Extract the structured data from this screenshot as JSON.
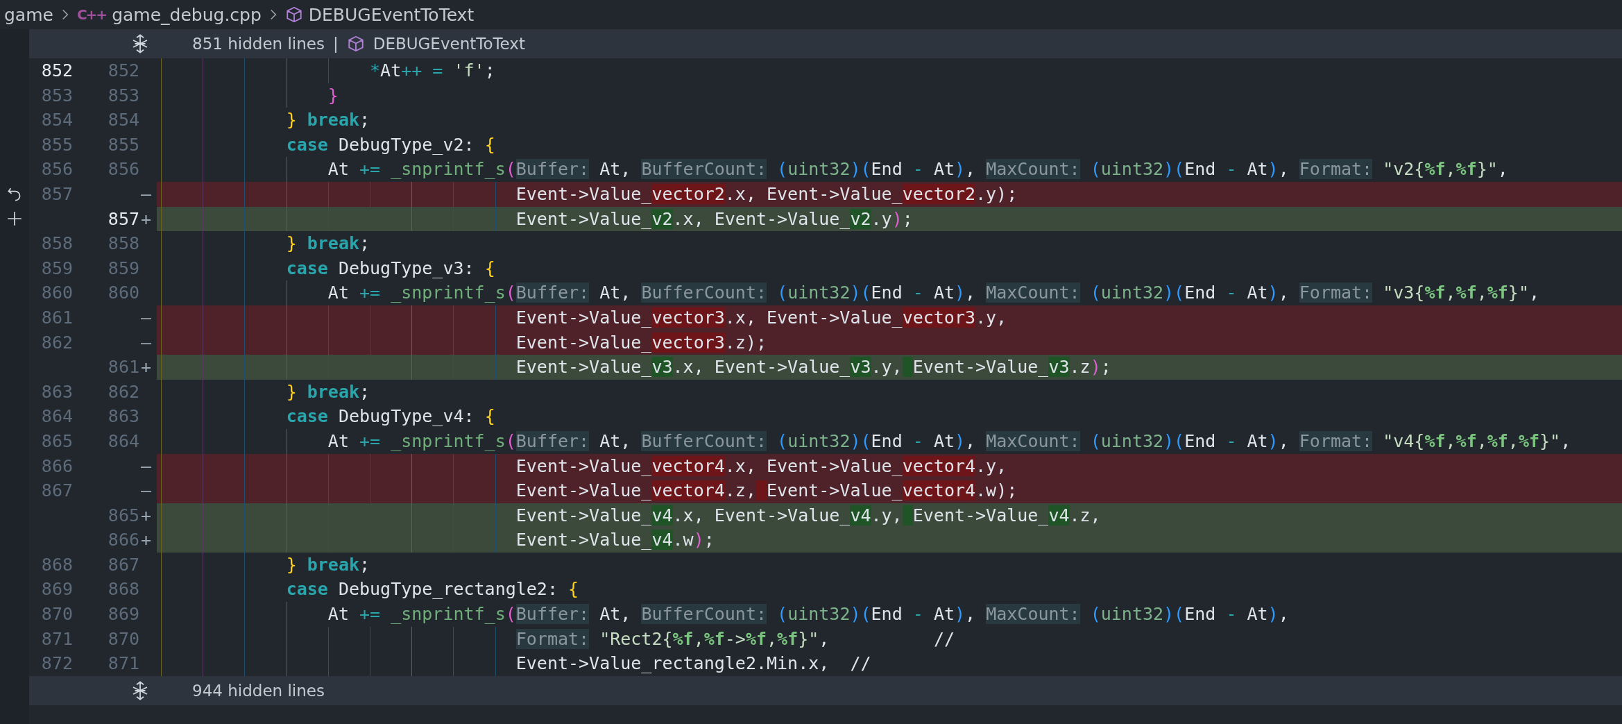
{
  "breadcrumbs": [
    {
      "kind": "folder",
      "text": "game"
    },
    {
      "kind": "file",
      "icon": "C++",
      "text": "game_debug.cpp"
    },
    {
      "kind": "symbol",
      "text": "DEBUGEventToText"
    }
  ],
  "top_fold": {
    "label": "851 hidden lines",
    "separator": "|",
    "symbol": "DEBUGEventToText"
  },
  "lines": [
    {
      "old": "852",
      "new": "852",
      "kind": "context",
      "active": true,
      "hovered": false,
      "code": [
        {
          "kind": "op",
          "text": "                    *"
        },
        {
          "kind": "plain",
          "text": "At"
        },
        {
          "kind": "op",
          "text": "++ = "
        },
        {
          "kind": "str",
          "text": "'f'"
        },
        {
          "kind": "plain",
          "text": ";"
        }
      ]
    },
    {
      "old": "853",
      "new": "853",
      "kind": "context",
      "active": false,
      "hovered": false,
      "code": [
        {
          "kind": "p1",
          "text": "                }"
        }
      ]
    },
    {
      "old": "854",
      "new": "854",
      "kind": "context",
      "active": false,
      "hovered": false,
      "code": [
        {
          "kind": "p3",
          "text": "            }"
        },
        {
          "kind": "keyword",
          "text": " break"
        },
        {
          "kind": "plain",
          "text": ";"
        }
      ]
    },
    {
      "old": "855",
      "new": "855",
      "kind": "context",
      "active": false,
      "hovered": false,
      "code": [
        {
          "kind": "keyword",
          "text": "            case"
        },
        {
          "kind": "plain",
          "text": " DebugType_v2: "
        },
        {
          "kind": "p3",
          "text": "{"
        }
      ]
    },
    {
      "old": "856",
      "new": "856",
      "kind": "context",
      "active": false,
      "hovered": false,
      "code": [
        {
          "kind": "plain",
          "text": "                At "
        },
        {
          "kind": "op",
          "text": "+= "
        },
        {
          "kind": "func",
          "text": "_snprintf_s"
        },
        {
          "kind": "p1",
          "text": "("
        },
        {
          "kind": "hint",
          "text": "Buffer:"
        },
        {
          "kind": "plain",
          "text": " At, "
        },
        {
          "kind": "hint",
          "text": "BufferCount:"
        },
        {
          "kind": "p2",
          "text": " ("
        },
        {
          "kind": "type",
          "text": "uint32"
        },
        {
          "kind": "p2",
          "text": ")("
        },
        {
          "kind": "plain",
          "text": "End "
        },
        {
          "kind": "op",
          "text": "- "
        },
        {
          "kind": "plain",
          "text": "At"
        },
        {
          "kind": "p2",
          "text": ")"
        },
        {
          "kind": "plain",
          "text": ", "
        },
        {
          "kind": "hint",
          "text": "MaxCount:"
        },
        {
          "kind": "p2",
          "text": " ("
        },
        {
          "kind": "type",
          "text": "uint32"
        },
        {
          "kind": "p2",
          "text": ")("
        },
        {
          "kind": "plain",
          "text": "End "
        },
        {
          "kind": "op",
          "text": "- "
        },
        {
          "kind": "plain",
          "text": "At"
        },
        {
          "kind": "p2",
          "text": ")"
        },
        {
          "kind": "plain",
          "text": ", "
        },
        {
          "kind": "hint",
          "text": "Format:"
        },
        {
          "kind": "str",
          "text": " \"v2{"
        },
        {
          "kind": "fmt",
          "text": "%f"
        },
        {
          "kind": "str",
          "text": ","
        },
        {
          "kind": "fmt",
          "text": "%f"
        },
        {
          "kind": "str",
          "text": "}\""
        },
        {
          "kind": "plain",
          "text": ","
        }
      ]
    },
    {
      "old": "857",
      "marker": "—",
      "kind": "removed",
      "active": false,
      "hovered": true,
      "code": [
        {
          "kind": "plain",
          "text": "                                  Event->Value_"
        },
        {
          "kind": "del",
          "text": "vector2"
        },
        {
          "kind": "plain",
          "text": ".x, Event->Value_"
        },
        {
          "kind": "del",
          "text": "vector2"
        },
        {
          "kind": "plain",
          "text": ".y);"
        }
      ]
    },
    {
      "new": "857",
      "marker": "+",
      "kind": "added",
      "active": true,
      "hovered": true,
      "code": [
        {
          "kind": "plain",
          "text": "                                  Event->Value_"
        },
        {
          "kind": "ins",
          "text": "v2"
        },
        {
          "kind": "plain",
          "text": ".x, Event->Value_"
        },
        {
          "kind": "ins",
          "text": "v2"
        },
        {
          "kind": "plain",
          "text": ".y"
        },
        {
          "kind": "p1",
          "text": ")"
        },
        {
          "kind": "plain",
          "text": ";"
        }
      ]
    },
    {
      "old": "858",
      "new": "858",
      "kind": "context",
      "active": false,
      "hovered": false,
      "code": [
        {
          "kind": "p3",
          "text": "            }"
        },
        {
          "kind": "keyword",
          "text": " break"
        },
        {
          "kind": "plain",
          "text": ";"
        }
      ]
    },
    {
      "old": "859",
      "new": "859",
      "kind": "context",
      "active": false,
      "hovered": false,
      "code": [
        {
          "kind": "keyword",
          "text": "            case"
        },
        {
          "kind": "plain",
          "text": " DebugType_v3: "
        },
        {
          "kind": "p3",
          "text": "{"
        }
      ]
    },
    {
      "old": "860",
      "new": "860",
      "kind": "context",
      "active": false,
      "hovered": false,
      "code": [
        {
          "kind": "plain",
          "text": "                At "
        },
        {
          "kind": "op",
          "text": "+= "
        },
        {
          "kind": "func",
          "text": "_snprintf_s"
        },
        {
          "kind": "p1",
          "text": "("
        },
        {
          "kind": "hint",
          "text": "Buffer:"
        },
        {
          "kind": "plain",
          "text": " At, "
        },
        {
          "kind": "hint",
          "text": "BufferCount:"
        },
        {
          "kind": "p2",
          "text": " ("
        },
        {
          "kind": "type",
          "text": "uint32"
        },
        {
          "kind": "p2",
          "text": ")("
        },
        {
          "kind": "plain",
          "text": "End "
        },
        {
          "kind": "op",
          "text": "- "
        },
        {
          "kind": "plain",
          "text": "At"
        },
        {
          "kind": "p2",
          "text": ")"
        },
        {
          "kind": "plain",
          "text": ", "
        },
        {
          "kind": "hint",
          "text": "MaxCount:"
        },
        {
          "kind": "p2",
          "text": " ("
        },
        {
          "kind": "type",
          "text": "uint32"
        },
        {
          "kind": "p2",
          "text": ")("
        },
        {
          "kind": "plain",
          "text": "End "
        },
        {
          "kind": "op",
          "text": "- "
        },
        {
          "kind": "plain",
          "text": "At"
        },
        {
          "kind": "p2",
          "text": ")"
        },
        {
          "kind": "plain",
          "text": ", "
        },
        {
          "kind": "hint",
          "text": "Format:"
        },
        {
          "kind": "str",
          "text": " \"v3{"
        },
        {
          "kind": "fmt",
          "text": "%f"
        },
        {
          "kind": "str",
          "text": ","
        },
        {
          "kind": "fmt",
          "text": "%f"
        },
        {
          "kind": "str",
          "text": ","
        },
        {
          "kind": "fmt",
          "text": "%f"
        },
        {
          "kind": "str",
          "text": "}\""
        },
        {
          "kind": "plain",
          "text": ","
        }
      ]
    },
    {
      "old": "861",
      "marker": "—",
      "kind": "removed",
      "active": false,
      "hovered": false,
      "code": [
        {
          "kind": "plain",
          "text": "                                  Event->Value_"
        },
        {
          "kind": "del",
          "text": "vector3"
        },
        {
          "kind": "plain",
          "text": ".x, Event->Value_"
        },
        {
          "kind": "del",
          "text": "vector3"
        },
        {
          "kind": "plain",
          "text": ".y,"
        }
      ]
    },
    {
      "old": "862",
      "marker": "—",
      "kind": "removed",
      "active": false,
      "hovered": false,
      "code": [
        {
          "kind": "plain",
          "text": "                                  Event->Value_"
        },
        {
          "kind": "del",
          "text": "vector3"
        },
        {
          "kind": "plain",
          "text": ".z);"
        }
      ]
    },
    {
      "new": "861",
      "marker": "+",
      "kind": "added",
      "active": false,
      "hovered": false,
      "code": [
        {
          "kind": "plain",
          "text": "                                  Event->Value_"
        },
        {
          "kind": "ins",
          "text": "v3"
        },
        {
          "kind": "plain",
          "text": ".x, Event->Value_"
        },
        {
          "kind": "ins",
          "text": "v3"
        },
        {
          "kind": "plain",
          "text": ".y,"
        },
        {
          "kind": "plain",
          "text": " Event->Value_",
          "changed_gap": true
        },
        {
          "kind": "ins",
          "text": "v3"
        },
        {
          "kind": "plain",
          "text": ".z"
        },
        {
          "kind": "p1",
          "text": ")"
        },
        {
          "kind": "plain",
          "text": ";"
        }
      ]
    },
    {
      "old": "863",
      "new": "862",
      "kind": "context",
      "active": false,
      "hovered": false,
      "code": [
        {
          "kind": "p3",
          "text": "            }"
        },
        {
          "kind": "keyword",
          "text": " break"
        },
        {
          "kind": "plain",
          "text": ";"
        }
      ]
    },
    {
      "old": "864",
      "new": "863",
      "kind": "context",
      "active": false,
      "hovered": false,
      "code": [
        {
          "kind": "keyword",
          "text": "            case"
        },
        {
          "kind": "plain",
          "text": " DebugType_v4: "
        },
        {
          "kind": "p3",
          "text": "{"
        }
      ]
    },
    {
      "old": "865",
      "new": "864",
      "kind": "context",
      "active": false,
      "hovered": false,
      "code": [
        {
          "kind": "plain",
          "text": "                At "
        },
        {
          "kind": "op",
          "text": "+= "
        },
        {
          "kind": "func",
          "text": "_snprintf_s"
        },
        {
          "kind": "p1",
          "text": "("
        },
        {
          "kind": "hint",
          "text": "Buffer:"
        },
        {
          "kind": "plain",
          "text": " At, "
        },
        {
          "kind": "hint",
          "text": "BufferCount:"
        },
        {
          "kind": "p2",
          "text": " ("
        },
        {
          "kind": "type",
          "text": "uint32"
        },
        {
          "kind": "p2",
          "text": ")("
        },
        {
          "kind": "plain",
          "text": "End "
        },
        {
          "kind": "op",
          "text": "- "
        },
        {
          "kind": "plain",
          "text": "At"
        },
        {
          "kind": "p2",
          "text": ")"
        },
        {
          "kind": "plain",
          "text": ", "
        },
        {
          "kind": "hint",
          "text": "MaxCount:"
        },
        {
          "kind": "p2",
          "text": " ("
        },
        {
          "kind": "type",
          "text": "uint32"
        },
        {
          "kind": "p2",
          "text": ")("
        },
        {
          "kind": "plain",
          "text": "End "
        },
        {
          "kind": "op",
          "text": "- "
        },
        {
          "kind": "plain",
          "text": "At"
        },
        {
          "kind": "p2",
          "text": ")"
        },
        {
          "kind": "plain",
          "text": ", "
        },
        {
          "kind": "hint",
          "text": "Format:"
        },
        {
          "kind": "str",
          "text": " \"v4{"
        },
        {
          "kind": "fmt",
          "text": "%f"
        },
        {
          "kind": "str",
          "text": ","
        },
        {
          "kind": "fmt",
          "text": "%f"
        },
        {
          "kind": "str",
          "text": ","
        },
        {
          "kind": "fmt",
          "text": "%f"
        },
        {
          "kind": "str",
          "text": ","
        },
        {
          "kind": "fmt",
          "text": "%f"
        },
        {
          "kind": "str",
          "text": "}\""
        },
        {
          "kind": "plain",
          "text": ","
        }
      ]
    },
    {
      "old": "866",
      "marker": "—",
      "kind": "removed",
      "active": false,
      "hovered": false,
      "code": [
        {
          "kind": "plain",
          "text": "                                  Event->Value_"
        },
        {
          "kind": "del",
          "text": "vector4"
        },
        {
          "kind": "plain",
          "text": ".x, Event->Value_"
        },
        {
          "kind": "del",
          "text": "vector4"
        },
        {
          "kind": "plain",
          "text": ".y,"
        }
      ]
    },
    {
      "old": "867",
      "marker": "—",
      "kind": "removed",
      "active": false,
      "hovered": false,
      "code": [
        {
          "kind": "plain",
          "text": "                                  Event->Value_"
        },
        {
          "kind": "del",
          "text": "vector4"
        },
        {
          "kind": "plain",
          "text": ".z,"
        },
        {
          "kind": "plain",
          "text": " Event->Value_",
          "changed_gap": true
        },
        {
          "kind": "del",
          "text": "vector4"
        },
        {
          "kind": "plain",
          "text": ".w);"
        }
      ]
    },
    {
      "new": "865",
      "marker": "+",
      "kind": "added",
      "active": false,
      "hovered": false,
      "code": [
        {
          "kind": "plain",
          "text": "                                  Event->Value_"
        },
        {
          "kind": "ins",
          "text": "v4"
        },
        {
          "kind": "plain",
          "text": ".x, Event->Value_"
        },
        {
          "kind": "ins",
          "text": "v4"
        },
        {
          "kind": "plain",
          "text": ".y,"
        },
        {
          "kind": "plain",
          "text": " Event->Value_",
          "changed_gap": true
        },
        {
          "kind": "ins",
          "text": "v4"
        },
        {
          "kind": "plain",
          "text": ".z,"
        }
      ]
    },
    {
      "new": "866",
      "marker": "+",
      "kind": "added",
      "active": false,
      "hovered": false,
      "code": [
        {
          "kind": "plain",
          "text": "                                  Event->Value_"
        },
        {
          "kind": "ins",
          "text": "v4"
        },
        {
          "kind": "plain",
          "text": ".w"
        },
        {
          "kind": "p1",
          "text": ")"
        },
        {
          "kind": "plain",
          "text": ";"
        }
      ]
    },
    {
      "old": "868",
      "new": "867",
      "kind": "context",
      "active": false,
      "hovered": false,
      "code": [
        {
          "kind": "p3",
          "text": "            }"
        },
        {
          "kind": "keyword",
          "text": " break"
        },
        {
          "kind": "plain",
          "text": ";"
        }
      ]
    },
    {
      "old": "869",
      "new": "868",
      "kind": "context",
      "active": false,
      "hovered": false,
      "code": [
        {
          "kind": "keyword",
          "text": "            case"
        },
        {
          "kind": "plain",
          "text": " DebugType_rectangle2: "
        },
        {
          "kind": "p3",
          "text": "{"
        }
      ]
    },
    {
      "old": "870",
      "new": "869",
      "kind": "context",
      "active": false,
      "hovered": false,
      "code": [
        {
          "kind": "plain",
          "text": "                At "
        },
        {
          "kind": "op",
          "text": "+= "
        },
        {
          "kind": "func",
          "text": "_snprintf_s"
        },
        {
          "kind": "p1",
          "text": "("
        },
        {
          "kind": "hint",
          "text": "Buffer:"
        },
        {
          "kind": "plain",
          "text": " At, "
        },
        {
          "kind": "hint",
          "text": "BufferCount:"
        },
        {
          "kind": "p2",
          "text": " ("
        },
        {
          "kind": "type",
          "text": "uint32"
        },
        {
          "kind": "p2",
          "text": ")("
        },
        {
          "kind": "plain",
          "text": "End "
        },
        {
          "kind": "op",
          "text": "- "
        },
        {
          "kind": "plain",
          "text": "At"
        },
        {
          "kind": "p2",
          "text": ")"
        },
        {
          "kind": "plain",
          "text": ", "
        },
        {
          "kind": "hint",
          "text": "MaxCount:"
        },
        {
          "kind": "p2",
          "text": " ("
        },
        {
          "kind": "type",
          "text": "uint32"
        },
        {
          "kind": "p2",
          "text": ")("
        },
        {
          "kind": "plain",
          "text": "End "
        },
        {
          "kind": "op",
          "text": "- "
        },
        {
          "kind": "plain",
          "text": "At"
        },
        {
          "kind": "p2",
          "text": ")"
        },
        {
          "kind": "plain",
          "text": ","
        }
      ]
    },
    {
      "old": "871",
      "new": "870",
      "kind": "context",
      "active": false,
      "hovered": false,
      "code": [
        {
          "kind": "hint",
          "text": "                                  Format:"
        },
        {
          "kind": "str",
          "text": " \"Rect2{"
        },
        {
          "kind": "fmt",
          "text": "%f"
        },
        {
          "kind": "str",
          "text": ","
        },
        {
          "kind": "fmt",
          "text": "%f"
        },
        {
          "kind": "str",
          "text": "->"
        },
        {
          "kind": "fmt",
          "text": "%f"
        },
        {
          "kind": "str",
          "text": ","
        },
        {
          "kind": "fmt",
          "text": "%f"
        },
        {
          "kind": "str",
          "text": "}\""
        },
        {
          "kind": "plain",
          "text": ",          //"
        }
      ]
    },
    {
      "old": "872",
      "new": "871",
      "kind": "context",
      "active": false,
      "hovered": false,
      "code": [
        {
          "kind": "plain",
          "text": "                                  Event->Value_rectangle2.Min.x,  //"
        }
      ]
    }
  ],
  "bottom_fold": {
    "label": "944 hidden lines"
  }
}
